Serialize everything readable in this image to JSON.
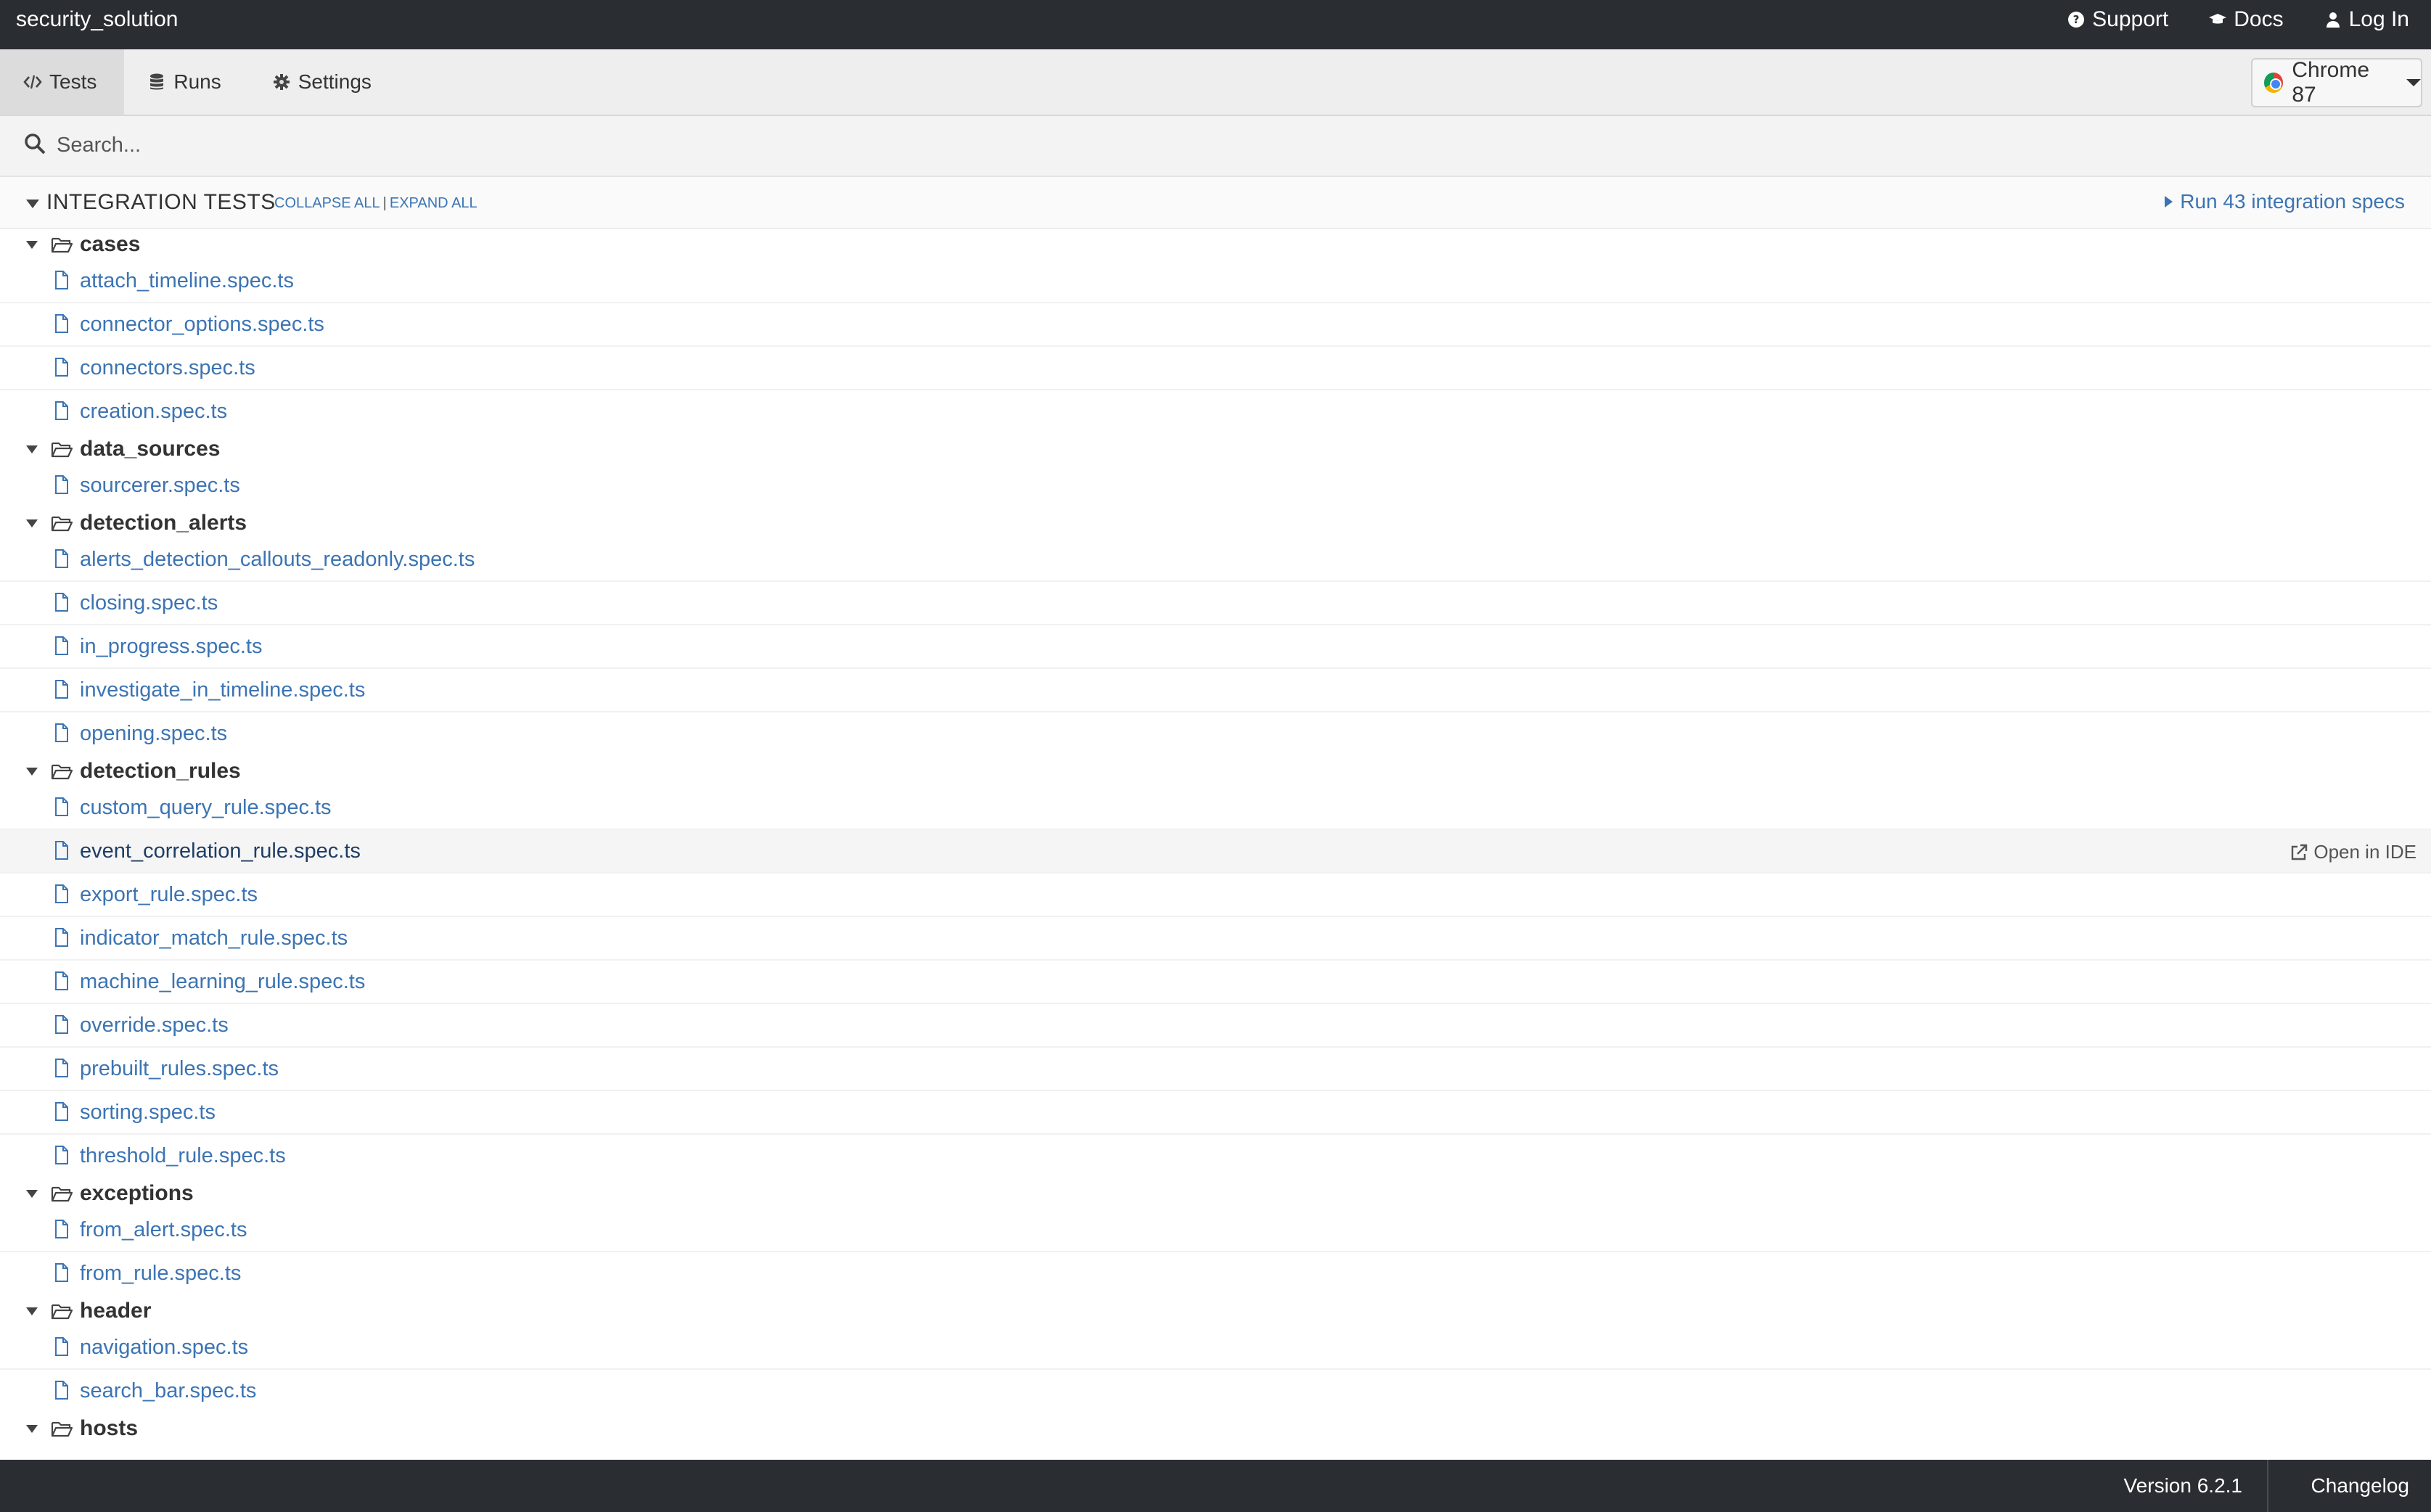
{
  "app": {
    "title": "security_solution"
  },
  "top_links": [
    {
      "label": "Support",
      "icon": "question-circle-icon"
    },
    {
      "label": "Docs",
      "icon": "graduation-cap-icon"
    },
    {
      "label": "Log In",
      "icon": "user-icon"
    }
  ],
  "nav": {
    "tabs": [
      {
        "label": "Tests",
        "icon": "code-icon",
        "active": true
      },
      {
        "label": "Runs",
        "icon": "database-icon",
        "active": false
      },
      {
        "label": "Settings",
        "icon": "gear-icon",
        "active": false
      }
    ],
    "browser": {
      "label": "Chrome 87",
      "icon": "chrome-icon"
    }
  },
  "search": {
    "placeholder": "Search...",
    "value": ""
  },
  "section": {
    "title": "INTEGRATION TESTS",
    "collapse_all": "COLLAPSE ALL",
    "separator": "|",
    "expand_all": "EXPAND ALL",
    "run_all": "Run 43 integration specs"
  },
  "open_in_ide": "Open in IDE",
  "tree": [
    {
      "folder": "cases",
      "files": [
        "attach_timeline.spec.ts",
        "connector_options.spec.ts",
        "connectors.spec.ts",
        "creation.spec.ts"
      ]
    },
    {
      "folder": "data_sources",
      "files": [
        "sourcerer.spec.ts"
      ]
    },
    {
      "folder": "detection_alerts",
      "files": [
        "alerts_detection_callouts_readonly.spec.ts",
        "closing.spec.ts",
        "in_progress.spec.ts",
        "investigate_in_timeline.spec.ts",
        "opening.spec.ts"
      ]
    },
    {
      "folder": "detection_rules",
      "files": [
        "custom_query_rule.spec.ts",
        "event_correlation_rule.spec.ts",
        "export_rule.spec.ts",
        "indicator_match_rule.spec.ts",
        "machine_learning_rule.spec.ts",
        "override.spec.ts",
        "prebuilt_rules.spec.ts",
        "sorting.spec.ts",
        "threshold_rule.spec.ts"
      ]
    },
    {
      "folder": "exceptions",
      "files": [
        "from_alert.spec.ts",
        "from_rule.spec.ts"
      ]
    },
    {
      "folder": "header",
      "files": [
        "navigation.spec.ts",
        "search_bar.spec.ts"
      ]
    },
    {
      "folder": "hosts",
      "files": []
    }
  ],
  "hovered_file": "event_correlation_rule.spec.ts",
  "footer": {
    "version": "Version 6.2.1",
    "changelog": "Changelog"
  },
  "colors": {
    "topbar": "#2a2d32",
    "link": "#3c74b3",
    "nav_bg": "#eeeeee"
  }
}
